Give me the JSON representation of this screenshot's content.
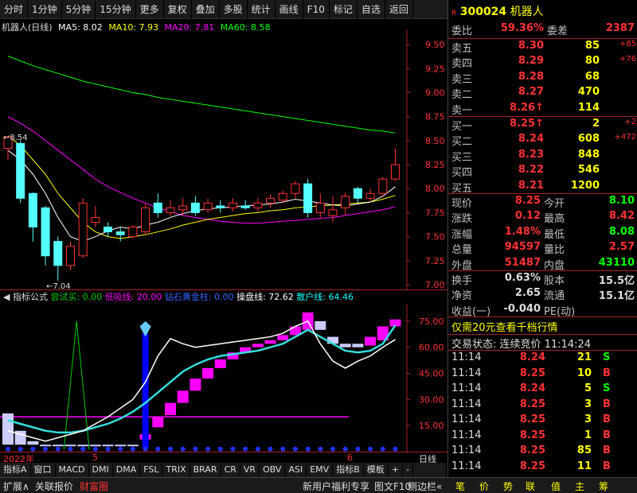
{
  "toolbar": [
    "分时",
    "1分钟",
    "5分钟",
    "15分钟",
    "更多",
    "复权",
    "叠加",
    "多股",
    "统计",
    "画线",
    "F10",
    "标记",
    "自选",
    "返回"
  ],
  "chart": {
    "stock_label": "机器人(日线)",
    "ma5": "MA5: 8.02",
    "ma10": "MA10: 7.93",
    "ma20": "MA20: 7.81",
    "ma60": "MA60: 8.58",
    "high_mark": "←8.54",
    "low_mark": "←7.04",
    "cai_mark": "财"
  },
  "yaxis_top": [
    "9.50",
    "9.25",
    "9.00",
    "8.75",
    "8.50",
    "8.25",
    "8.00",
    "7.75",
    "7.50",
    "7.25",
    "7.00"
  ],
  "indicator": {
    "name": "指标公式",
    "a_label": "尝试买: 0.00",
    "b_label": "低吸线: 20.00",
    "c_label": "钻石黄金柱: 0.00",
    "d_label": "操盘线: 72.62",
    "e_label": "散户线: 64.46"
  },
  "yaxis_bottom": [
    "75.00",
    "60.00",
    "45.00",
    "30.00",
    "15.00"
  ],
  "xaxis": {
    "year": "2022年",
    "m5": "5",
    "m6": "6",
    "period": "日线"
  },
  "tabs": [
    "指标A",
    "窗口",
    "MACD",
    "DMI",
    "DMA",
    "FSL",
    "TRIX",
    "BRAR",
    "CR",
    "VR",
    "OBV",
    "ASI",
    "EMV",
    "指标B",
    "模板",
    "+",
    "-"
  ],
  "status": [
    "扩展∧",
    "关联报价",
    "财富圈",
    "新用户福利专享",
    "图文F10",
    "侧边栏«",
    "笔",
    "价",
    "势",
    "联",
    "值",
    "主",
    "筹"
  ],
  "quote": {
    "code": "300024",
    "name": "机器人",
    "weibi_label": "委比",
    "weibi": "59.36%",
    "weicha_label": "委差",
    "weicha": "2387",
    "sell": [
      {
        "label": "卖五",
        "price": "8.30",
        "vol": "85",
        "delta": "+85"
      },
      {
        "label": "卖四",
        "price": "8.29",
        "vol": "80",
        "delta": "+76"
      },
      {
        "label": "卖三",
        "price": "8.28",
        "vol": "68",
        "delta": ""
      },
      {
        "label": "卖二",
        "price": "8.27",
        "vol": "470",
        "delta": ""
      },
      {
        "label": "卖一",
        "price": "8.26↑",
        "vol": "114",
        "delta": ""
      }
    ],
    "buy": [
      {
        "label": "买一",
        "price": "8.25↑",
        "vol": "2",
        "delta": "+2"
      },
      {
        "label": "买二",
        "price": "8.24",
        "vol": "608",
        "delta": "+472"
      },
      {
        "label": "买三",
        "price": "8.23",
        "vol": "848",
        "delta": ""
      },
      {
        "label": "买四",
        "price": "8.22",
        "vol": "546",
        "delta": ""
      },
      {
        "label": "买五",
        "price": "8.21",
        "vol": "1200",
        "delta": ""
      }
    ],
    "stats": [
      {
        "l1": "现价",
        "v1": "8.25",
        "l2": "今开",
        "v2": "8.10"
      },
      {
        "l1": "涨跌",
        "v1": "0.12",
        "l2": "最高",
        "v2": "8.42"
      },
      {
        "l1": "涨幅",
        "v1": "1.48%",
        "l2": "最低",
        "v2": "8.08"
      },
      {
        "l1": "总量",
        "v1": "94597",
        "l2": "量比",
        "v2": "2.57"
      },
      {
        "l1": "外盘",
        "v1": "51487",
        "l2": "内盘",
        "v2": "43110"
      }
    ],
    "stats2": [
      {
        "l1": "换手",
        "v1": "0.63%",
        "l2": "股本",
        "v2": "15.5亿"
      },
      {
        "l1": "净资",
        "v1": "2.65",
        "l2": "流通",
        "v2": "15.1亿"
      },
      {
        "l1": "收益(一)",
        "v1": "-0.040",
        "l2": "PE(动)",
        "v2": ""
      }
    ],
    "promo": "仅需20元查看千档行情",
    "trade_state": "交易状态: 连续竞价 11:14:24",
    "ticks": [
      {
        "t": "11:14",
        "p": "8.24",
        "v": "21",
        "s": "S"
      },
      {
        "t": "11:14",
        "p": "8.25",
        "v": "10",
        "s": "B"
      },
      {
        "t": "11:14",
        "p": "8.24",
        "v": "5",
        "s": "S"
      },
      {
        "t": "11:14",
        "p": "8.25",
        "v": "3",
        "s": "B"
      },
      {
        "t": "11:14",
        "p": "8.25",
        "v": "3",
        "s": "B"
      },
      {
        "t": "11:14",
        "p": "8.25",
        "v": "1",
        "s": "B"
      },
      {
        "t": "11:14",
        "p": "8.25",
        "v": "85",
        "s": "B"
      },
      {
        "t": "11:14",
        "p": "8.25",
        "v": "11",
        "s": "B"
      }
    ]
  },
  "chart_data": {
    "type": "candlestick",
    "candles": [
      {
        "o": 8.42,
        "c": 8.54,
        "h": 8.54,
        "l": 8.3
      },
      {
        "o": 8.47,
        "c": 7.9,
        "h": 8.5,
        "l": 7.85
      },
      {
        "o": 7.95,
        "c": 7.6,
        "h": 7.96,
        "l": 7.45
      },
      {
        "o": 7.8,
        "c": 7.3,
        "h": 7.82,
        "l": 7.2
      },
      {
        "o": 7.45,
        "c": 7.2,
        "h": 7.5,
        "l": 7.04
      },
      {
        "o": 7.2,
        "c": 7.4,
        "h": 7.45,
        "l": 7.15
      },
      {
        "o": 7.3,
        "c": 7.85,
        "h": 7.9,
        "l": 7.28
      },
      {
        "o": 7.65,
        "c": 7.7,
        "h": 7.82,
        "l": 7.6
      },
      {
        "o": 7.6,
        "c": 7.55,
        "h": 7.65,
        "l": 7.5
      },
      {
        "o": 7.55,
        "c": 7.52,
        "h": 7.6,
        "l": 7.45
      },
      {
        "o": 7.5,
        "c": 7.6,
        "h": 7.62,
        "l": 7.48
      },
      {
        "o": 7.55,
        "c": 7.8,
        "h": 7.85,
        "l": 7.52
      },
      {
        "o": 7.85,
        "c": 7.75,
        "h": 7.95,
        "l": 7.7
      },
      {
        "o": 7.75,
        "c": 7.8,
        "h": 7.88,
        "l": 7.72
      },
      {
        "o": 7.78,
        "c": 7.82,
        "h": 7.9,
        "l": 7.72
      },
      {
        "o": 7.85,
        "c": 7.75,
        "h": 7.92,
        "l": 7.72
      },
      {
        "o": 7.78,
        "c": 7.85,
        "h": 7.9,
        "l": 7.75
      },
      {
        "o": 7.82,
        "c": 7.8,
        "h": 7.88,
        "l": 7.75
      },
      {
        "o": 7.8,
        "c": 7.85,
        "h": 7.9,
        "l": 7.76
      },
      {
        "o": 7.82,
        "c": 7.8,
        "h": 7.88,
        "l": 7.78
      },
      {
        "o": 7.8,
        "c": 7.85,
        "h": 7.9,
        "l": 7.76
      },
      {
        "o": 7.85,
        "c": 7.9,
        "h": 7.94,
        "l": 7.8
      },
      {
        "o": 7.88,
        "c": 7.95,
        "h": 7.98,
        "l": 7.85
      },
      {
        "o": 7.95,
        "c": 8.05,
        "h": 8.08,
        "l": 7.9
      },
      {
        "o": 8.05,
        "c": 7.75,
        "h": 8.1,
        "l": 7.7
      },
      {
        "o": 7.75,
        "c": 7.85,
        "h": 7.95,
        "l": 7.7
      },
      {
        "o": 7.72,
        "c": 7.78,
        "h": 7.92,
        "l": 7.65
      },
      {
        "o": 7.8,
        "c": 7.92,
        "h": 7.96,
        "l": 7.72
      },
      {
        "o": 8.0,
        "c": 7.9,
        "h": 8.02,
        "l": 7.85
      },
      {
        "o": 7.9,
        "c": 7.95,
        "h": 8.0,
        "l": 7.86
      },
      {
        "o": 7.95,
        "c": 8.1,
        "h": 8.12,
        "l": 7.92
      },
      {
        "o": 8.1,
        "c": 8.25,
        "h": 8.42,
        "l": 8.08
      }
    ],
    "ma5": [
      8.4,
      8.3,
      8.15,
      7.95,
      7.7,
      7.5,
      7.45,
      7.5,
      7.56,
      7.6,
      7.58,
      7.62,
      7.65,
      7.7,
      7.74,
      7.77,
      7.79,
      7.8,
      7.81,
      7.82,
      7.83,
      7.84,
      7.86,
      7.89,
      7.87,
      7.85,
      7.83,
      7.82,
      7.84,
      7.86,
      7.92,
      8.02
    ],
    "ma10": [
      8.55,
      8.45,
      8.3,
      8.15,
      7.95,
      7.8,
      7.65,
      7.55,
      7.5,
      7.48,
      7.5,
      7.52,
      7.55,
      7.58,
      7.62,
      7.65,
      7.68,
      7.7,
      7.72,
      7.74,
      7.75,
      7.77,
      7.78,
      7.8,
      7.81,
      7.82,
      7.83,
      7.84,
      7.85,
      7.86,
      7.89,
      7.93
    ],
    "ma20": [
      8.75,
      8.68,
      8.6,
      8.5,
      8.4,
      8.3,
      8.2,
      8.1,
      8.02,
      7.96,
      7.9,
      7.85,
      7.8,
      7.76,
      7.72,
      7.7,
      7.68,
      7.66,
      7.65,
      7.64,
      7.64,
      7.65,
      7.66,
      7.67,
      7.68,
      7.69,
      7.7,
      7.72,
      7.74,
      7.76,
      7.78,
      7.81
    ],
    "ma60": [
      9.38,
      9.33,
      9.28,
      9.24,
      9.2,
      9.16,
      9.12,
      9.09,
      9.06,
      9.03,
      9.0,
      8.98,
      8.95,
      8.93,
      8.91,
      8.89,
      8.87,
      8.85,
      8.83,
      8.81,
      8.79,
      8.77,
      8.75,
      8.73,
      8.71,
      8.69,
      8.67,
      8.65,
      8.63,
      8.61,
      8.6,
      8.58
    ],
    "ylim": [
      6.95,
      9.65
    ],
    "indicator": {
      "white": [
        12,
        10,
        8,
        6,
        8,
        10,
        12,
        16,
        20,
        25,
        30,
        40,
        55,
        65,
        62,
        60,
        61,
        62,
        63,
        64,
        65,
        66,
        68,
        72,
        75,
        62,
        52,
        48,
        52,
        55,
        60,
        64.46
      ],
      "cyan": [
        18,
        16,
        14,
        12,
        11,
        11,
        12,
        14,
        16,
        19,
        23,
        28,
        34,
        40,
        46,
        50,
        53,
        55,
        56,
        57,
        58,
        60,
        62,
        66,
        70,
        66,
        62,
        58,
        57,
        58,
        62,
        72.62
      ],
      "low_line": 20,
      "bars_low": [
        4,
        4,
        4,
        4,
        4,
        4,
        4,
        4,
        4,
        4,
        4,
        7,
        14,
        21,
        28,
        35,
        42,
        48,
        53,
        57,
        60,
        62,
        64,
        67,
        70,
        70,
        62,
        60,
        60,
        61,
        64,
        72
      ],
      "bars_high": [
        22,
        12,
        6,
        4,
        4,
        4,
        4,
        4,
        4,
        4,
        4,
        10,
        20,
        28,
        35,
        42,
        48,
        53,
        57,
        60,
        62,
        64,
        67,
        72,
        80,
        75,
        66,
        62,
        62,
        66,
        72,
        76
      ],
      "bars_color": [
        "#ccccff",
        "#ccccff",
        "#ccccff",
        "#ccccff",
        "#ccccff",
        "#ccccff",
        "#ccccff",
        "#ccccff",
        "#ccccff",
        "#ccccff",
        "#ccccff",
        "#ff00ff",
        "#ff00ff",
        "#ff00ff",
        "#ff00ff",
        "#ff00ff",
        "#ff00ff",
        "#ff00ff",
        "#ff00ff",
        "#ff00ff",
        "#ff00ff",
        "#ff00ff",
        "#ff00ff",
        "#ff00ff",
        "#ff00ff",
        "#ccccff",
        "#ccccff",
        "#ccccff",
        "#ccccff",
        "#ff00ff",
        "#ff00ff",
        "#ff00ff"
      ],
      "green_spike_index": 6,
      "blue_bar_index": 11,
      "ylim": [
        0,
        85
      ]
    }
  }
}
